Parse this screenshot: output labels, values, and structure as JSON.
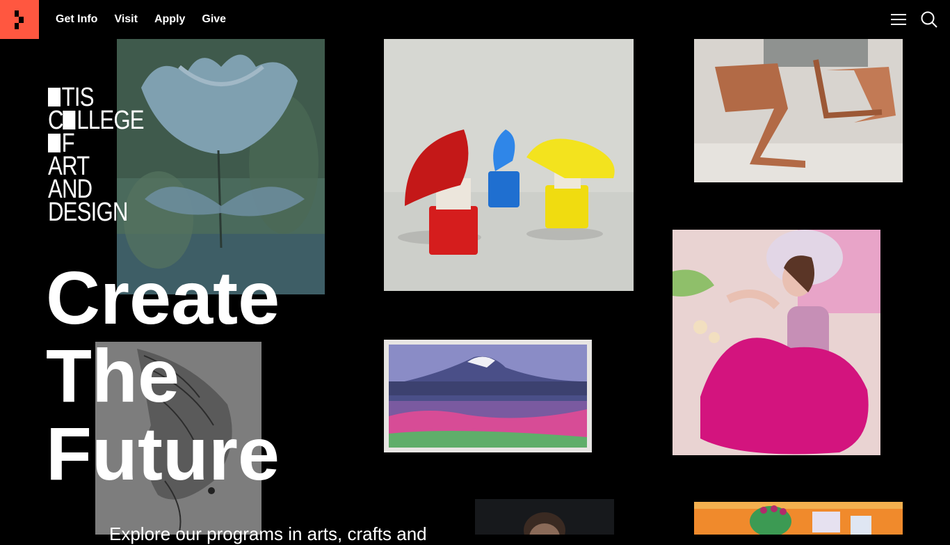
{
  "nav": {
    "items": [
      {
        "label": "Get Info"
      },
      {
        "label": "Visit"
      },
      {
        "label": "Apply"
      },
      {
        "label": "Give"
      }
    ],
    "icons": [
      "logo-mark-icon",
      "menu-icon",
      "search-icon"
    ]
  },
  "wordmark": {
    "lines": [
      "TIS",
      "C",
      "LLEGE",
      "F",
      "ART",
      "AND",
      "DESIGN"
    ]
  },
  "hero": {
    "line1": "Create",
    "line2": "The",
    "line3": "Future",
    "subtitle": "Explore our programs in arts, crafts and"
  },
  "colors": {
    "brand": "#ff5740",
    "background": "#000000",
    "text": "#ffffff"
  },
  "gallery": {
    "items": [
      {
        "name": "blue-flower-painting"
      },
      {
        "name": "sprayer-product-design"
      },
      {
        "name": "copper-chair-model"
      },
      {
        "name": "landscape-train-illustration"
      },
      {
        "name": "pink-dress-photograph"
      },
      {
        "name": "fish-ink-drawing"
      },
      {
        "name": "portrait-photograph"
      },
      {
        "name": "colorful-illustration"
      }
    ]
  }
}
